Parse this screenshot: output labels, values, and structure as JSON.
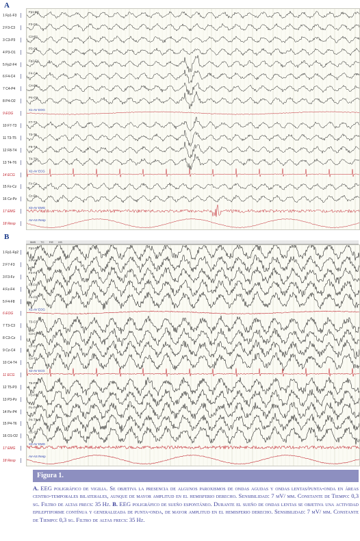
{
  "panels": [
    {
      "letter": "A",
      "channels": [
        {
          "label": "1 Fp1-F3",
          "tag": "Fp1-F3",
          "kind": "eeg"
        },
        {
          "label": "2 F3-C3",
          "tag": "F3-C3",
          "kind": "eeg"
        },
        {
          "label": "3 C3-P3",
          "tag": "C3-P3",
          "kind": "eeg"
        },
        {
          "label": "4 P3-O1",
          "tag": "P3-O1",
          "kind": "eeg"
        },
        {
          "label": "5 Fp2-F4",
          "tag": "Fp2-F4",
          "kind": "eeg"
        },
        {
          "label": "6 F4-C4",
          "tag": "F4-C4",
          "kind": "eeg"
        },
        {
          "label": "7 C4-P4",
          "tag": "C4-P4",
          "kind": "eeg"
        },
        {
          "label": "8 P4-O2",
          "tag": "P4-O2",
          "kind": "eeg"
        },
        {
          "label": "9 EOG",
          "tag": "X1-AV  EOG",
          "kind": "eog"
        },
        {
          "label": "10 F7-T3",
          "tag": "F7-T3",
          "kind": "eeg"
        },
        {
          "label": "11 T3-T5",
          "tag": "T3-T5",
          "kind": "eeg"
        },
        {
          "label": "12 F8-T4",
          "tag": "F8-T4",
          "kind": "eeg"
        },
        {
          "label": "13 T4-T6",
          "tag": "T4-T6",
          "kind": "eeg"
        },
        {
          "label": "14 ECG",
          "tag": "X2-AV  ECG",
          "kind": "ecg"
        },
        {
          "label": "15 Fz-Cz",
          "tag": "Fz-Cz",
          "kind": "eeg"
        },
        {
          "label": "16 Cz-Pz",
          "tag": "Cz-Pz",
          "kind": "eeg"
        },
        {
          "label": "17 EMG",
          "tag": "X3-AV  EMG",
          "kind": "emg"
        },
        {
          "label": "18 Resp",
          "tag": "AV-AS  Resp",
          "kind": "resp"
        }
      ]
    },
    {
      "letter": "B",
      "channels": [
        {
          "label": "1 Fp1-Fp2",
          "tag": "Fp1-F3",
          "kind": "eeg"
        },
        {
          "label": "2 F7-F3",
          "tag": "F7-F3",
          "kind": "eeg"
        },
        {
          "label": "3 F3-Fz",
          "tag": "F3-Fz",
          "kind": "eeg"
        },
        {
          "label": "4 Fz-F4",
          "tag": "Fz-F4",
          "kind": "eeg"
        },
        {
          "label": "5 F4-F8",
          "tag": "F4-F8",
          "kind": "eeg"
        },
        {
          "label": "6 EOG",
          "tag": "X1-AV  EOG",
          "kind": "eog"
        },
        {
          "label": "7 T3-C3",
          "tag": "T3-C3",
          "kind": "eeg"
        },
        {
          "label": "8 C3-Cz",
          "tag": "C3-Cz",
          "kind": "eeg"
        },
        {
          "label": "9 Cz-C4",
          "tag": "Cz-C4",
          "kind": "eeg"
        },
        {
          "label": "10 C4-T4",
          "tag": "C4-T4",
          "kind": "eeg"
        },
        {
          "label": "11 ECG",
          "tag": "X2-AV  ECG",
          "kind": "ecg"
        },
        {
          "label": "12 T5-P3",
          "tag": "T5-P3",
          "kind": "eeg"
        },
        {
          "label": "13 P3-Pz",
          "tag": "P3-Pz",
          "kind": "eeg"
        },
        {
          "label": "14 Pz-P4",
          "tag": "Pz-P4",
          "kind": "eeg"
        },
        {
          "label": "15 P4-T6",
          "tag": "P4-T6",
          "kind": "eeg"
        },
        {
          "label": "16 O1-O2",
          "tag": "O1-O2",
          "kind": "eeg"
        },
        {
          "label": "17 EMG",
          "tag": "X3-AV  EMG",
          "kind": "emg"
        },
        {
          "label": "18 Resp",
          "tag": "AV-AS  Resp",
          "kind": "resp"
        }
      ]
    }
  ],
  "toolbar_b": [
    "5MS",
    "TC",
    "F/E",
    "HS"
  ],
  "caption": {
    "title": "Figura 1.",
    "a_letter": "A.",
    "a_text": "EEG poligráfico de vigilia. Se objetiva la presencia de algunos paroxismos de ondas agudas y ondas lentas/punta-onda en áreas centro-temporales bilaterales, aunque de mayor amplitud en el hemisferio derecho. Sensibilidad: 7 mV/ mm. Constante de Tiempo: 0,3 sg. Filtro de altas frecs: 35 Hz.",
    "b_letter": "B.",
    "b_text": "EEG poligráfico de sueño espontáneo. Durante el sueño de ondas lentas se objetiva una actividad epileptiforme contínua y generalizada de punta-onda, de mayor amplitud en el hemisferio derecho. Sensibilidad: 7 mV/ mm. Constante de Tiempo: 0,3 sg. Filtro de altas frecs: 35 Hz."
  },
  "colors": {
    "eeg": "#1b1b1b",
    "eog": "#c0202a",
    "ecg": "#c0202a",
    "emg": "#c0202a",
    "resp": "#c0202a",
    "blue_label": "#2b40b0",
    "grid": "#d8d8c8",
    "caption_bar": "#8d8fc0",
    "caption_text": "#3b3f9a"
  }
}
